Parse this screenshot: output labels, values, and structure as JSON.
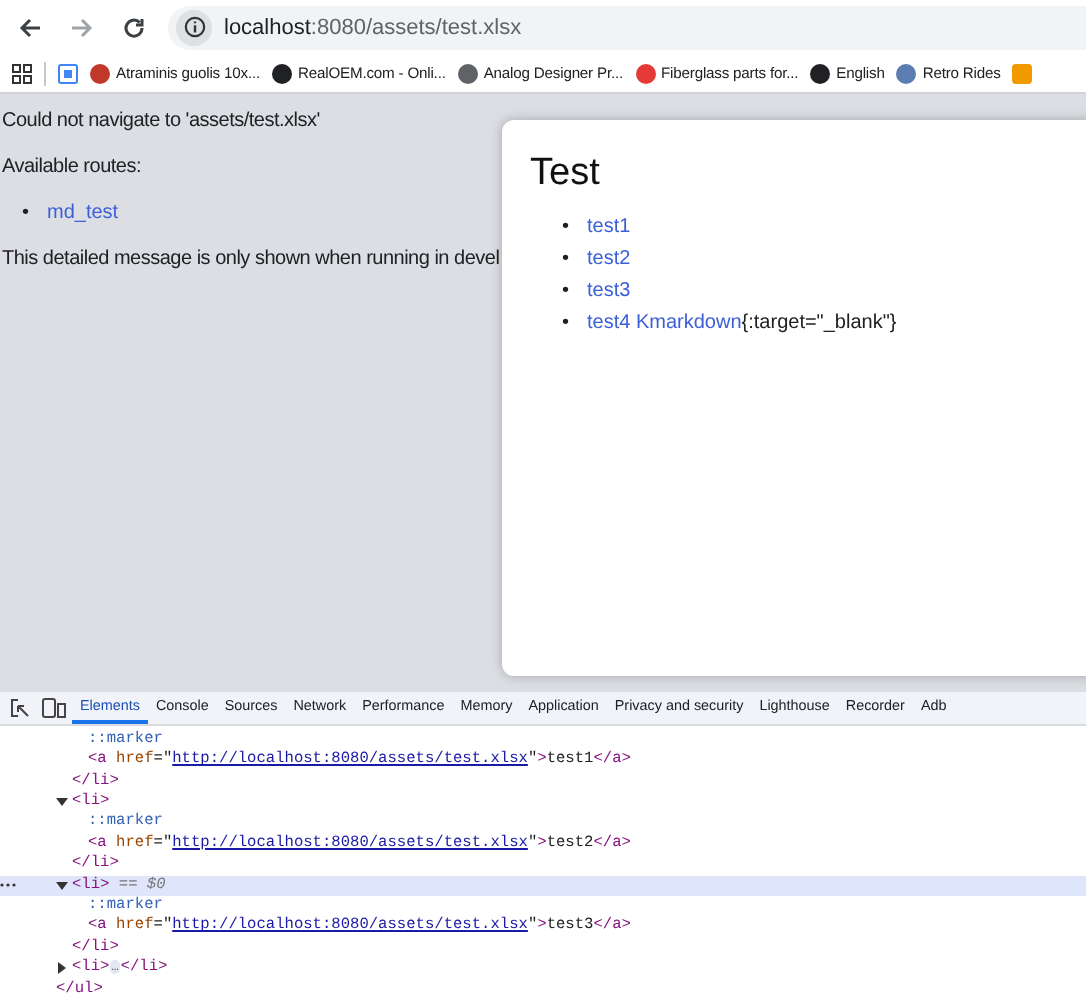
{
  "browser": {
    "back_disabled": false,
    "forward_disabled": true,
    "url_host": "localhost",
    "url_rest": ":8080/assets/test.xlsx"
  },
  "bookmarks": [
    {
      "label": "Atraminis guolis 10x...",
      "color": "#c0392b"
    },
    {
      "label": "RealOEM.com - Onli...",
      "color": "#202124"
    },
    {
      "label": "Analog Designer Pr...",
      "color": "#5f6368"
    },
    {
      "label": "Fiberglass parts for...",
      "color": "#e53935"
    },
    {
      "label": "English",
      "color": "#202124"
    },
    {
      "label": "Retro Rides",
      "color": "#5b7db1"
    }
  ],
  "page": {
    "error": "Could not navigate to 'assets/test.xlsx'",
    "routes_label": "Available routes:",
    "routes": [
      {
        "marker": "•",
        "label": "md_test"
      }
    ],
    "note": "This detailed message is only shown when running in devel"
  },
  "dialog": {
    "title": "Test",
    "items": [
      {
        "marker": "•",
        "link": "test1"
      },
      {
        "marker": "•",
        "link": "test2"
      },
      {
        "marker": "•",
        "link": "test3"
      },
      {
        "marker": "•",
        "link": "test4 Kmarkdown",
        "suffix": "{:target=\"_blank\"}"
      }
    ]
  },
  "devtools": {
    "tabs": [
      {
        "label": "Elements",
        "selected": true
      },
      {
        "label": "Console",
        "selected": false
      },
      {
        "label": "Sources",
        "selected": false
      },
      {
        "label": "Network",
        "selected": false
      },
      {
        "label": "Performance",
        "selected": false
      },
      {
        "label": "Memory",
        "selected": false
      },
      {
        "label": "Application",
        "selected": false
      },
      {
        "label": "Privacy and security",
        "selected": false
      },
      {
        "label": "Lighthouse",
        "selected": false
      },
      {
        "label": "Recorder",
        "selected": false
      },
      {
        "label": "Adb",
        "selected": false
      }
    ],
    "dom": [
      {
        "close": [
          {
            "kind": "tag",
            "text": "</ul>"
          }
        ],
        "children": [
          {
            "close": [
              {
                "kind": "tag",
                "text": "</li>"
              }
            ],
            "children": [
              {
                "open": [
                  {
                    "kind": "pseudo",
                    "text": "::marker"
                  }
                ]
              },
              {
                "open": [
                  {
                    "kind": "tag",
                    "text": "<a"
                  },
                  {
                    "kind": "attr",
                    "text": " href"
                  },
                  {
                    "kind": "plain",
                    "text": "=\""
                  },
                  {
                    "kind": "url",
                    "text": "http://localhost:8080/assets/test.xlsx"
                  },
                  {
                    "kind": "plain",
                    "text": "\""
                  },
                  {
                    "kind": "tag",
                    "text": ">"
                  },
                  {
                    "kind": "plain",
                    "text": "test1"
                  },
                  {
                    "kind": "tag",
                    "text": "</a>"
                  }
                ]
              }
            ]
          },
          {
            "open": [
              {
                "kind": "tag",
                "text": "<li>"
              }
            ],
            "expanded": true,
            "selected": false,
            "close": [
              {
                "kind": "tag",
                "text": "</li>"
              }
            ],
            "children": [
              {
                "open": [
                  {
                    "kind": "pseudo",
                    "text": "::marker"
                  }
                ]
              },
              {
                "open": [
                  {
                    "kind": "tag",
                    "text": "<a"
                  },
                  {
                    "kind": "attr",
                    "text": " href"
                  },
                  {
                    "kind": "plain",
                    "text": "=\""
                  },
                  {
                    "kind": "url",
                    "text": "http://localhost:8080/assets/test.xlsx"
                  },
                  {
                    "kind": "plain",
                    "text": "\""
                  },
                  {
                    "kind": "tag",
                    "text": ">"
                  },
                  {
                    "kind": "plain",
                    "text": "test2"
                  },
                  {
                    "kind": "tag",
                    "text": "</a>"
                  }
                ]
              }
            ]
          },
          {
            "open": [
              {
                "kind": "tag",
                "text": "<li>"
              },
              {
                "kind": "note",
                "text": " == $0"
              }
            ],
            "expanded": true,
            "selected": true,
            "close": [
              {
                "kind": "tag",
                "text": "</li>"
              }
            ],
            "children": [
              {
                "open": [
                  {
                    "kind": "pseudo",
                    "text": "::marker"
                  }
                ]
              },
              {
                "open": [
                  {
                    "kind": "tag",
                    "text": "<a"
                  },
                  {
                    "kind": "attr",
                    "text": " href"
                  },
                  {
                    "kind": "plain",
                    "text": "=\""
                  },
                  {
                    "kind": "url",
                    "text": "http://localhost:8080/assets/test.xlsx"
                  },
                  {
                    "kind": "plain",
                    "text": "\""
                  },
                  {
                    "kind": "tag",
                    "text": ">"
                  },
                  {
                    "kind": "plain",
                    "text": "test3"
                  },
                  {
                    "kind": "tag",
                    "text": "</a>"
                  }
                ]
              }
            ]
          },
          {
            "open": [
              {
                "kind": "tag",
                "text": "<li>"
              },
              {
                "kind": "ellipsis",
                "text": "…"
              },
              {
                "kind": "tag",
                "text": "</li>"
              }
            ],
            "expanded": false,
            "selected": false
          }
        ]
      }
    ]
  }
}
